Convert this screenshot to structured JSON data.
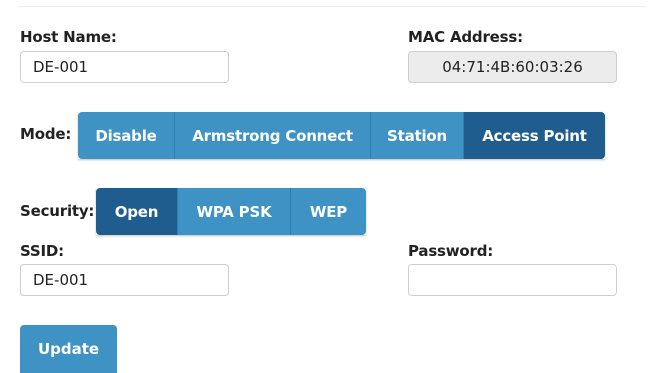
{
  "host": {
    "label": "Host Name:",
    "value": "DE-001"
  },
  "mac": {
    "label": "MAC Address:",
    "value": "04:71:4B:60:03:26"
  },
  "mode": {
    "label": "Mode:",
    "options": [
      "Disable",
      "Armstrong Connect",
      "Station",
      "Access Point"
    ],
    "selected": "Access Point"
  },
  "security": {
    "label": "Security:",
    "options": [
      "Open",
      "WPA PSK",
      "WEP"
    ],
    "selected": "Open"
  },
  "ssid": {
    "label": "SSID:",
    "value": "DE-001"
  },
  "password": {
    "label": "Password:",
    "value": ""
  },
  "update_label": "Update",
  "colors": {
    "button": "#3f93c4",
    "button_active": "#205d8f"
  }
}
